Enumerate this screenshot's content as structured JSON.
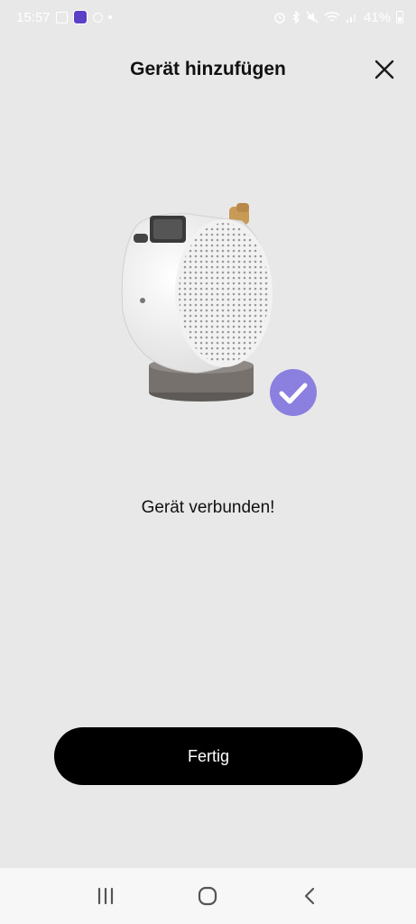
{
  "status_bar": {
    "time": "15:57",
    "battery": "41%",
    "icons": [
      "image-icon",
      "app-icon",
      "notification-icon",
      "dot-icon",
      "alarm-icon",
      "bluetooth-icon",
      "mute-icon",
      "wifi-icon",
      "signal-icon",
      "battery-icon"
    ]
  },
  "header": {
    "title": "Gerät hinzufügen",
    "close_icon": "close-icon"
  },
  "device": {
    "image": "projector-image",
    "badge_icon": "checkmark-icon",
    "badge_color": "#8b7fe0"
  },
  "message": "Gerät verbunden!",
  "done_button": {
    "label": "Fertig",
    "color": "#000000"
  },
  "nav_bar": {
    "items": [
      "recent-apps-icon",
      "home-icon",
      "back-icon"
    ]
  }
}
